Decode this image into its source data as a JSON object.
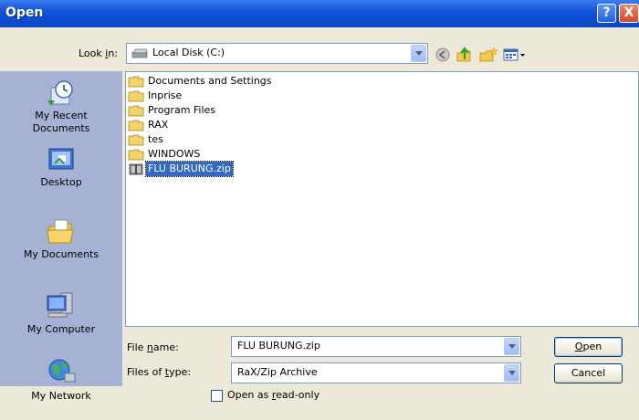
{
  "title": "Open",
  "title_buttons": {
    "help": "?",
    "close": "X"
  },
  "look_in": {
    "label_pre": "Look ",
    "label_key": "i",
    "label_post": "n:",
    "value": "Local Disk (C:)"
  },
  "places": [
    {
      "id": "recent",
      "label_line1": "My Recent",
      "label_line2": "Documents"
    },
    {
      "id": "desktop",
      "label_line1": "Desktop",
      "label_line2": ""
    },
    {
      "id": "mydocs",
      "label_line1": "My Documents",
      "label_line2": ""
    },
    {
      "id": "mycomputer",
      "label_line1": "My Computer",
      "label_line2": ""
    },
    {
      "id": "network",
      "label_line1": "My Network",
      "label_line2": ""
    }
  ],
  "files": [
    {
      "name": "Documents and Settings",
      "type": "folder"
    },
    {
      "name": "Inprise",
      "type": "folder"
    },
    {
      "name": "Program Files",
      "type": "folder"
    },
    {
      "name": "RAX",
      "type": "folder"
    },
    {
      "name": "tes",
      "type": "folder"
    },
    {
      "name": "WINDOWS",
      "type": "folder"
    },
    {
      "name": "FLU BURUNG.zip",
      "type": "zip",
      "selected": true
    }
  ],
  "file_name": {
    "label_pre": "File ",
    "label_key": "n",
    "label_post": "ame:",
    "value": "FLU BURUNG.zip"
  },
  "file_type": {
    "label_pre": "Files of ",
    "label_key": "t",
    "label_post": "ype:",
    "value": "RaX/Zip Archive"
  },
  "read_only": {
    "label_pre": "Open as ",
    "label_key": "r",
    "label_post": "ead-only",
    "checked": false
  },
  "buttons": {
    "open_key": "O",
    "open_rest": "pen",
    "cancel": "Cancel"
  },
  "colors": {
    "titlebar": "#0a4fd3",
    "places_bar": "#a6b2d4",
    "dialog": "#ece9d8",
    "selection": "#316ac5"
  }
}
